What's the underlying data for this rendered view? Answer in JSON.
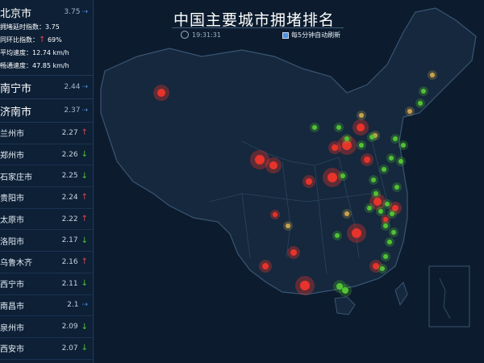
{
  "header": {
    "title": "中国主要城市拥堵排名",
    "time": "19:31:31",
    "refresh_label": "每5分钟自动刷新"
  },
  "top_city": {
    "name": "北京市",
    "value": "3.75",
    "trend": "flat",
    "details": [
      {
        "label": "拥堵延时指数：",
        "value": "3.75"
      },
      {
        "label": "同环比指数：",
        "arrow": "↑",
        "value": "69%"
      },
      {
        "label": "平均速度：",
        "value": "12.74 km/h"
      },
      {
        "label": "畅通速度：",
        "value": "47.85 km/h"
      }
    ]
  },
  "big_rows": [
    {
      "name": "南宁市",
      "value": "2.44",
      "trend": "flat"
    },
    {
      "name": "济南市",
      "value": "2.37",
      "trend": "flat"
    }
  ],
  "rows": [
    {
      "name": "兰州市",
      "value": "2.27",
      "trend": "up"
    },
    {
      "name": "郑州市",
      "value": "2.26",
      "trend": "down"
    },
    {
      "name": "石家庄市",
      "value": "2.25",
      "trend": "down"
    },
    {
      "name": "贵阳市",
      "value": "2.24",
      "trend": "up"
    },
    {
      "name": "太原市",
      "value": "2.22",
      "trend": "up"
    },
    {
      "name": "洛阳市",
      "value": "2.17",
      "trend": "down"
    },
    {
      "name": "乌鲁木齐",
      "value": "2.16",
      "trend": "up"
    },
    {
      "name": "西宁市",
      "value": "2.11",
      "trend": "down"
    },
    {
      "name": "南昌市",
      "value": "2.1",
      "trend": "flat"
    },
    {
      "name": "泉州市",
      "value": "2.09",
      "trend": "down"
    },
    {
      "name": "西安市",
      "value": "2.07",
      "trend": "down"
    }
  ],
  "colors": {
    "up": "#e0474c",
    "down": "#52c232",
    "flat": "#4a90e2",
    "hot": "#e8332a",
    "mid": "#c9a24b",
    "cool": "#52c232"
  }
}
